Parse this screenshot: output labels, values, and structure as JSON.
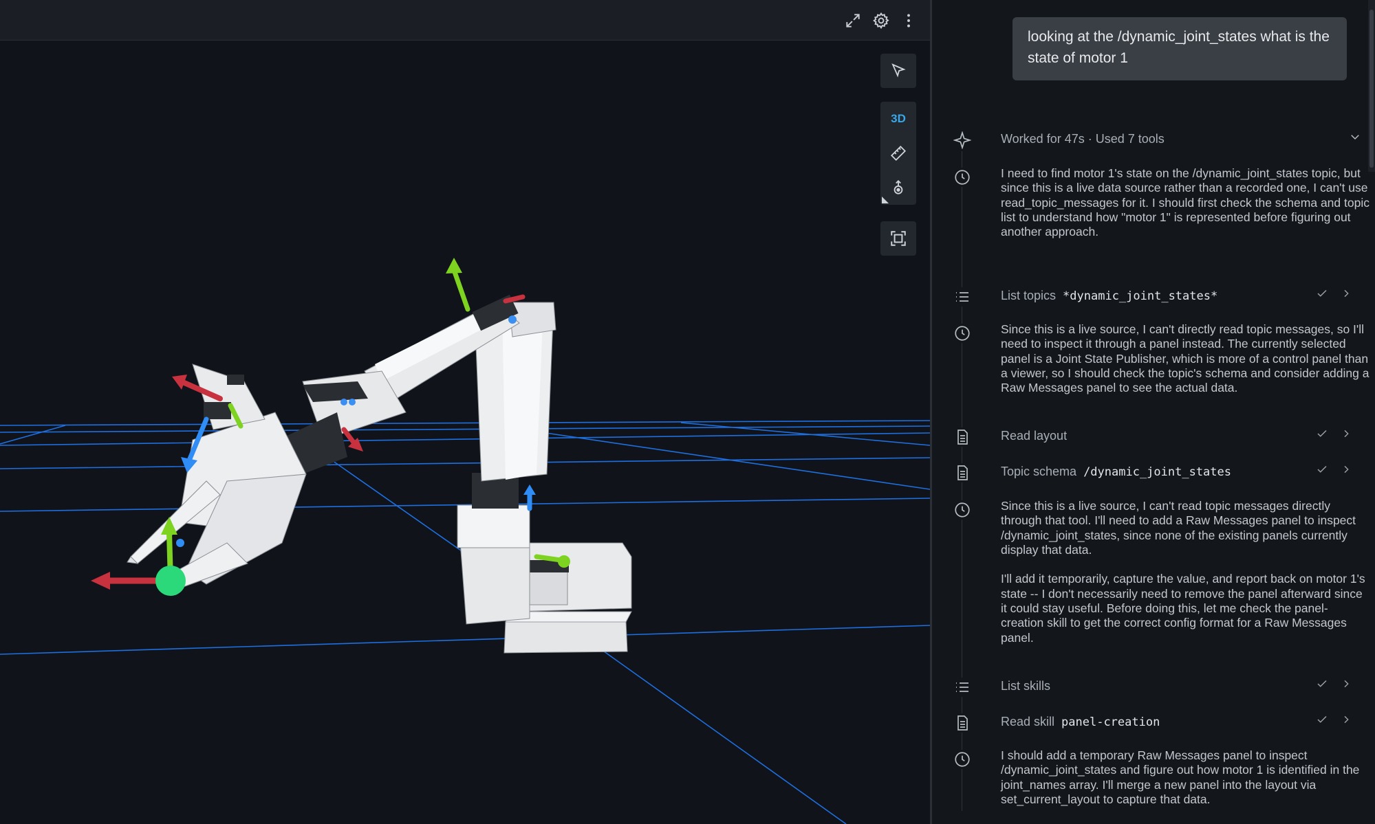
{
  "colors": {
    "background": "#10141a",
    "grid": "#1e6fe0",
    "accent": "#3aa7e8",
    "axis_x": "#c8323f",
    "axis_y": "#7ed321",
    "axis_z": "#2f8df5"
  },
  "viewport": {
    "toolbar_icons": [
      "fullscreen-icon",
      "gear-icon",
      "more-vertical-icon"
    ],
    "controls": {
      "select": "cursor-icon",
      "mode_3d": "3D",
      "measure": "ruler-icon",
      "publish": "publish-point-icon",
      "follow": "frame-icon"
    }
  },
  "chat": {
    "user_message": "looking at the /dynamic_joint_states what is the state of motor 1",
    "summary": {
      "label": "Worked for 47s · Used 7 tools",
      "icon": "sparkle-icon"
    },
    "steps": [
      {
        "kind": "thought",
        "text": "I need to find motor 1's state on the /dynamic_joint_states topic, but since this is a live data source rather than a recorded one, I can't use read_topic_messages for it. I should first check the schema and topic list to understand how \"motor 1\" is represented before figuring out another approach."
      },
      {
        "kind": "tool",
        "icon": "list-icon",
        "label": "List topics",
        "arg": "*dynamic_joint_states*"
      },
      {
        "kind": "thought",
        "text": "Since this is a live source, I can't directly read topic messages, so I'll need to inspect it through a panel instead. The currently selected panel is a Joint State Publisher, which is more of a control panel than a viewer, so I should check the topic's schema and consider adding a Raw Messages panel to see the actual data."
      },
      {
        "kind": "tool",
        "icon": "file-icon",
        "label": "Read layout",
        "arg": ""
      },
      {
        "kind": "tool",
        "icon": "file-icon",
        "label": "Topic schema",
        "arg": "/dynamic_joint_states"
      },
      {
        "kind": "thought",
        "text": "Since this is a live source, I can't read topic messages directly through that tool. I'll need to add a Raw Messages panel to inspect /dynamic_joint_states, since none of the existing panels currently display that data.\n\nI'll add it temporarily, capture the value, and report back on motor 1's state -- I don't necessarily need to remove the panel afterward since it could stay useful. Before doing this, let me check the panel-creation skill to get the correct config format for a Raw Messages panel."
      },
      {
        "kind": "tool",
        "icon": "list-icon",
        "label": "List skills",
        "arg": ""
      },
      {
        "kind": "tool",
        "icon": "file-icon",
        "label": "Read skill",
        "arg": "panel-creation"
      },
      {
        "kind": "thought",
        "text": "I should add a temporary Raw Messages panel to inspect /dynamic_joint_states and figure out how motor 1 is identified in the joint_names array. I'll merge a new panel into the layout via set_current_layout to capture that data."
      }
    ]
  }
}
